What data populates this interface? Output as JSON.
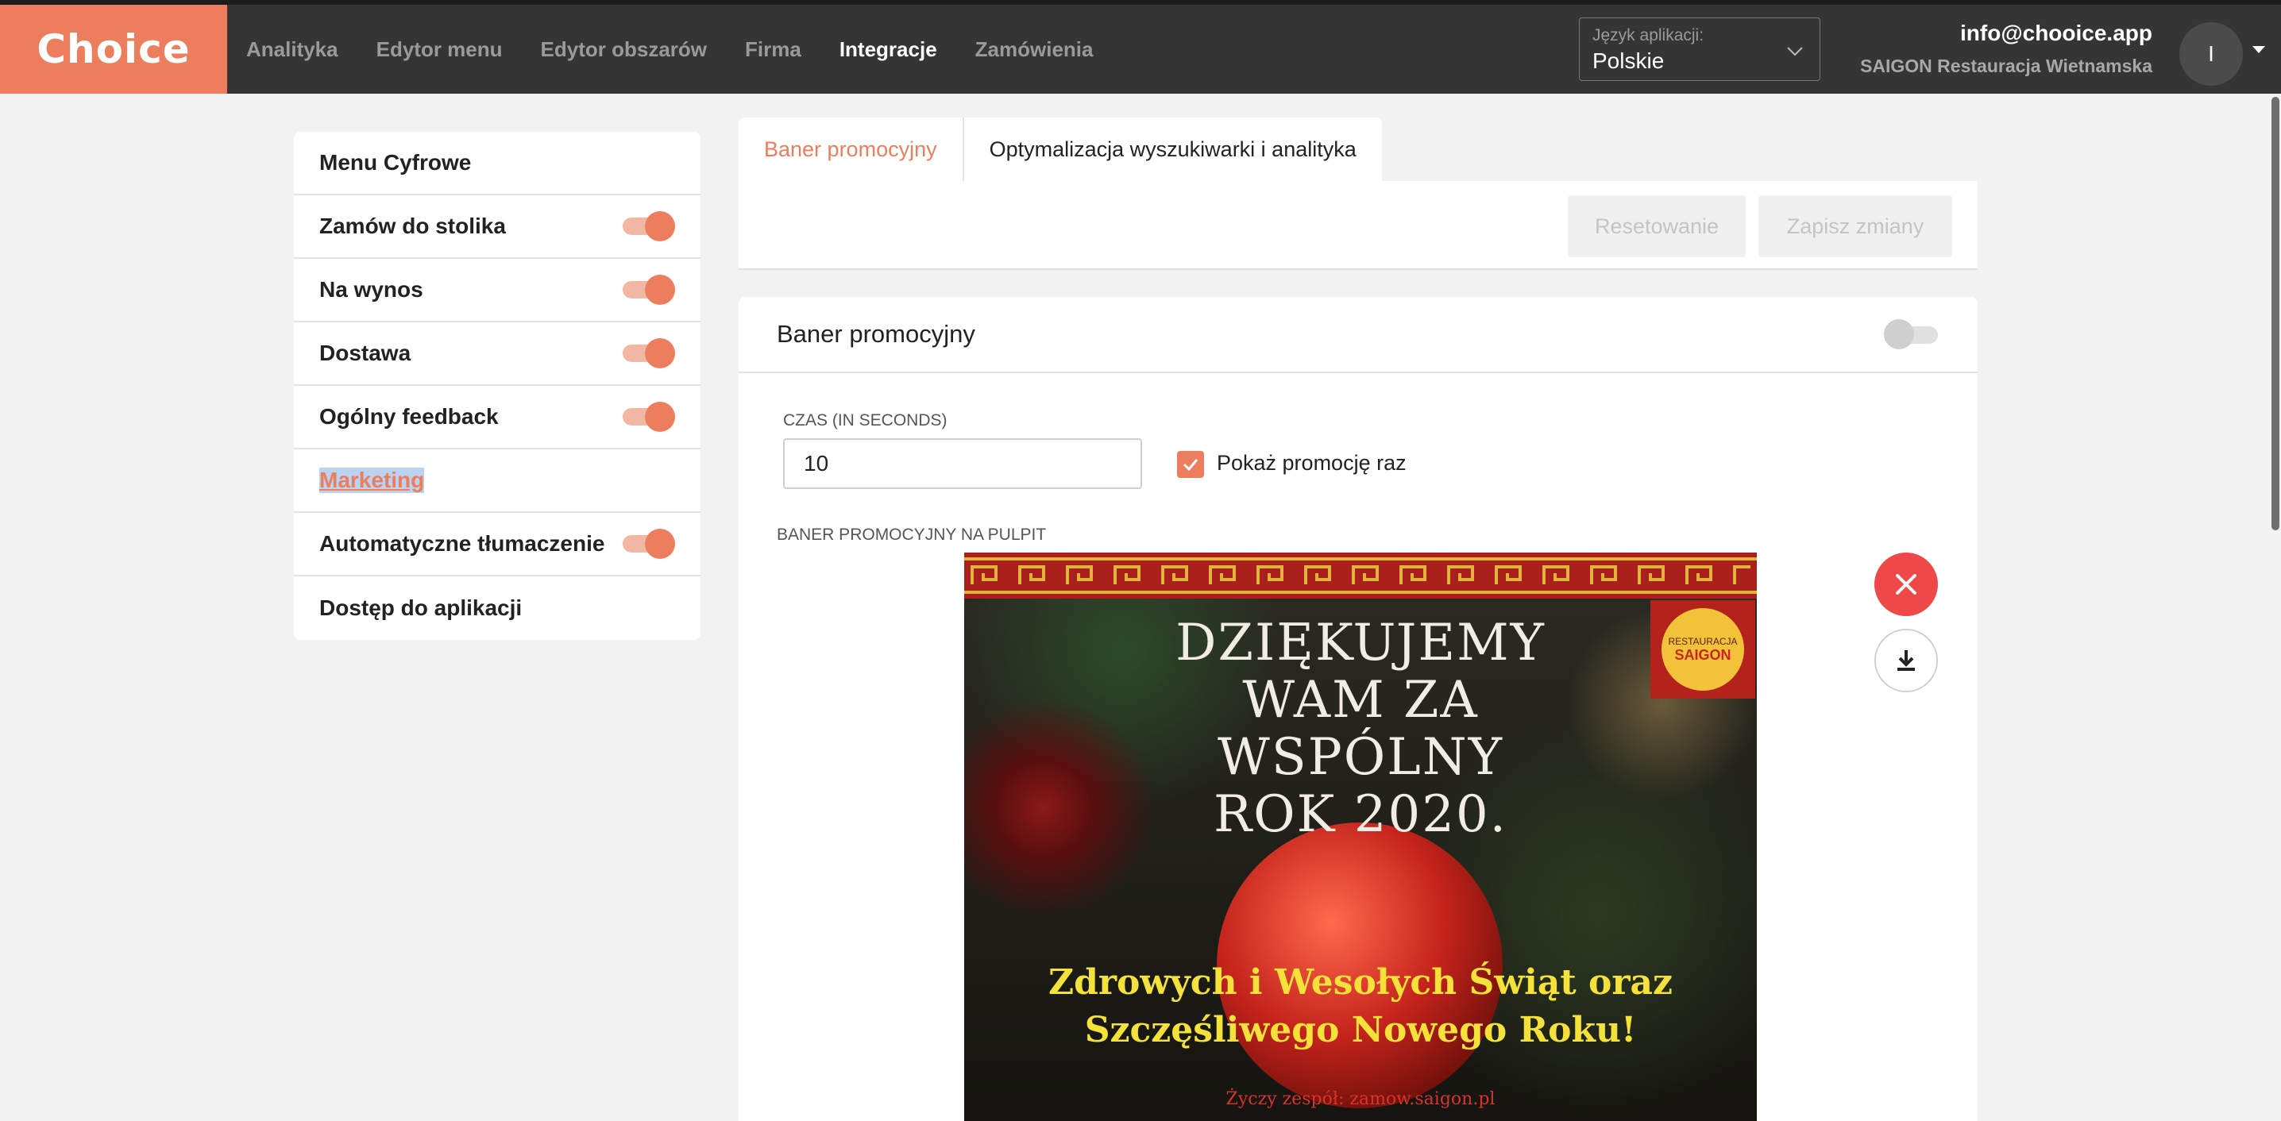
{
  "app": {
    "logo": "Choice"
  },
  "nav": {
    "items": [
      {
        "label": "Analityka",
        "active": false
      },
      {
        "label": "Edytor menu",
        "active": false
      },
      {
        "label": "Edytor obszarów",
        "active": false
      },
      {
        "label": "Firma",
        "active": false
      },
      {
        "label": "Integracje",
        "active": true
      },
      {
        "label": "Zamówienia",
        "active": false
      }
    ]
  },
  "language": {
    "label": "Język aplikacji:",
    "value": "Polskie"
  },
  "account": {
    "email": "info@chooice.app",
    "restaurant": "SAIGON Restauracja Wietnamska",
    "avatar_letter": "I"
  },
  "sidebar": {
    "items": [
      {
        "label": "Menu Cyfrowe",
        "toggle": false
      },
      {
        "label": "Zamów do stolika",
        "toggle": true
      },
      {
        "label": "Na wynos",
        "toggle": true
      },
      {
        "label": "Dostawa",
        "toggle": true
      },
      {
        "label": "Ogólny feedback",
        "toggle": true
      },
      {
        "label": "Marketing",
        "toggle": false
      },
      {
        "label": "Automatyczne tłumaczenie",
        "toggle": true
      },
      {
        "label": "Dostęp do aplikacji",
        "toggle": false
      }
    ]
  },
  "tabs": [
    {
      "label": "Baner promocyjny",
      "active": true
    },
    {
      "label": "Optymalizacja wyszukiwarki i analityka",
      "active": false
    }
  ],
  "actions": {
    "reset_label": "Resetowanie",
    "save_label": "Zapisz zmiany"
  },
  "card": {
    "title": "Baner promocyjny",
    "enabled": false,
    "time_label": "CZAS (IN SECONDS)",
    "time_value": "10",
    "show_once_label": "Pokaż promocję raz",
    "show_once_checked": true,
    "banner_label": "BANER PROMOCYJNY NA PULPIT"
  },
  "banner": {
    "line1": "DZIĘKUJEMY",
    "line2": "WAM ZA",
    "line3": "WSPÓLNY",
    "line4": "ROK 2020.",
    "wish1": "Zdrowych i Wesołych Świąt oraz",
    "wish2": "Szczęśliwego Nowego Roku!",
    "sign": "Życzy zespół: zamow.saigon.pl",
    "stamp_top": "RESTAURACJA",
    "stamp_name": "SAIGON"
  },
  "colors": {
    "accent": "#ec7e5e",
    "topbar": "#353535",
    "danger": "#ef4848"
  },
  "icons": {
    "language_chevron": "chevron-down-icon",
    "remove": "close-icon",
    "download": "download-icon",
    "checkbox": "check-icon"
  }
}
